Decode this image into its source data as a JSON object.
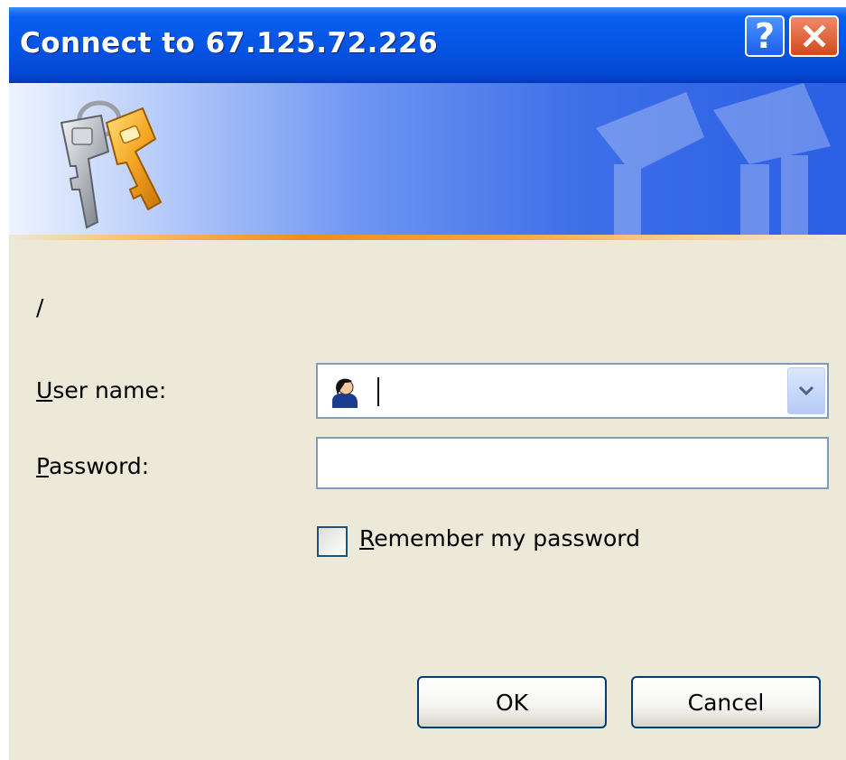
{
  "window": {
    "title": "Connect to 67.125.72.226",
    "help_label": "?",
    "close_icon": "close-icon",
    "help_icon": "help-icon"
  },
  "banner": {
    "icon": "keys-icon",
    "accent_color": "#f08c1e"
  },
  "realm": "/",
  "form": {
    "username_label": "User name:",
    "username_value": "",
    "username_icon": "user-avatar-icon",
    "password_label": "Password:",
    "password_value": "",
    "remember_label": "Remember my password",
    "remember_checked": false
  },
  "buttons": {
    "ok": "OK",
    "cancel": "Cancel"
  },
  "colors": {
    "titlebar": "#0554e3",
    "dialog_bg": "#ece9d8",
    "field_border": "#7f9db9",
    "button_border": "#003c74"
  }
}
